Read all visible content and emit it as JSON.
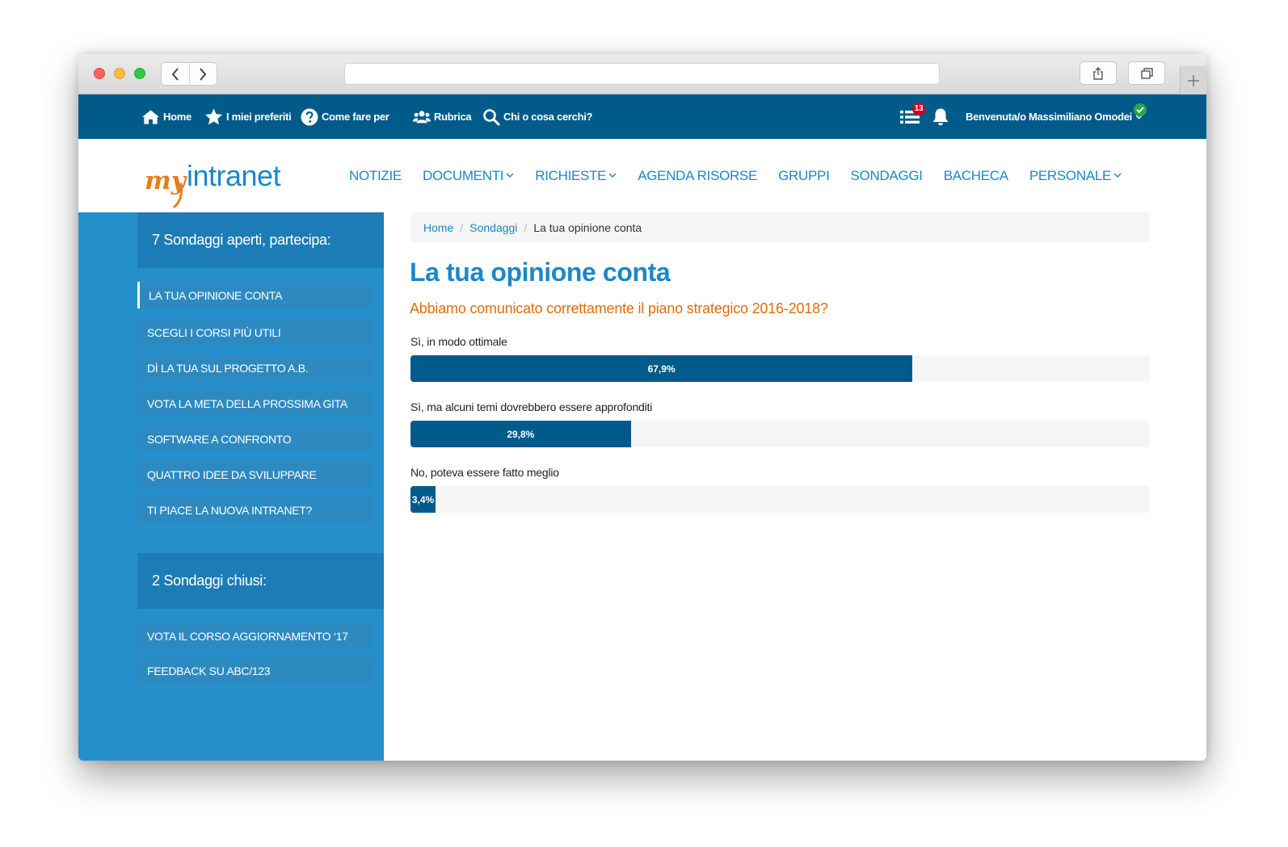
{
  "topbar": {
    "home": "Home",
    "favorites": "I miei preferiti",
    "howto": "Come fare per",
    "contacts": "Rubrica",
    "search": "Chi o cosa cerchi?",
    "tasks_badge": "13",
    "welcome": "Benvenuta/o Massimiliano Omodei"
  },
  "logo": {
    "brand_left": "my",
    "brand_right": "intranet",
    "color_left": "#e67e22",
    "color_right": "#1c87c9"
  },
  "mainnav": {
    "items": [
      {
        "label": "NOTIZIE"
      },
      {
        "label": "DOCUMENTI"
      },
      {
        "label": "RICHIESTE"
      },
      {
        "label": "AGENDA RISORSE"
      },
      {
        "label": "GRUPPI"
      },
      {
        "label": "SONDAGGI"
      },
      {
        "label": "BACHECA"
      },
      {
        "label": "PERSONALE"
      }
    ]
  },
  "sidebar": {
    "open_title": "7 Sondaggi aperti, partecipa:",
    "open_items": [
      "LA TUA OPINIONE CONTA",
      "SCEGLI I CORSI PIÙ UTILI",
      "DÌ LA TUA SUL PROGETTO A.B.",
      "VOTA LA META DELLA PROSSIMA GITA",
      "SOFTWARE A CONFRONTO",
      "QUATTRO IDEE DA SVILUPPARE",
      "TI PIACE LA NUOVA INTRANET?"
    ],
    "closed_title": "2 Sondaggi chiusi:",
    "closed_items": [
      "VOTA IL CORSO AGGIORNAMENTO  ‘17",
      "FEEDBACK SU ABC/123"
    ]
  },
  "breadcrumb": {
    "home": "Home",
    "section": "Sondaggi",
    "current": "La tua opinione conta"
  },
  "poll": {
    "title": "La tua opinione conta",
    "question": "Abbiamo comunicato correttamente il piano strategico 2016-2018?",
    "options": [
      {
        "label": "Sì, in modo ottimale",
        "percent": 67.9,
        "display": "67,9%"
      },
      {
        "label": "Sì, ma alcuni temi dovrebbero essere approfonditi",
        "percent": 29.8,
        "display": "29,8%"
      },
      {
        "label": "No, poteva essere fatto meglio",
        "percent": 3.4,
        "display": "3,4%"
      }
    ]
  },
  "colors": {
    "topbar": "#005b8a",
    "accent": "#1c87c9",
    "sidebar": "#258fcb",
    "question": "#e46c0a",
    "bar_fill": "#005b8a",
    "bar_track": "#f5f5f5"
  }
}
